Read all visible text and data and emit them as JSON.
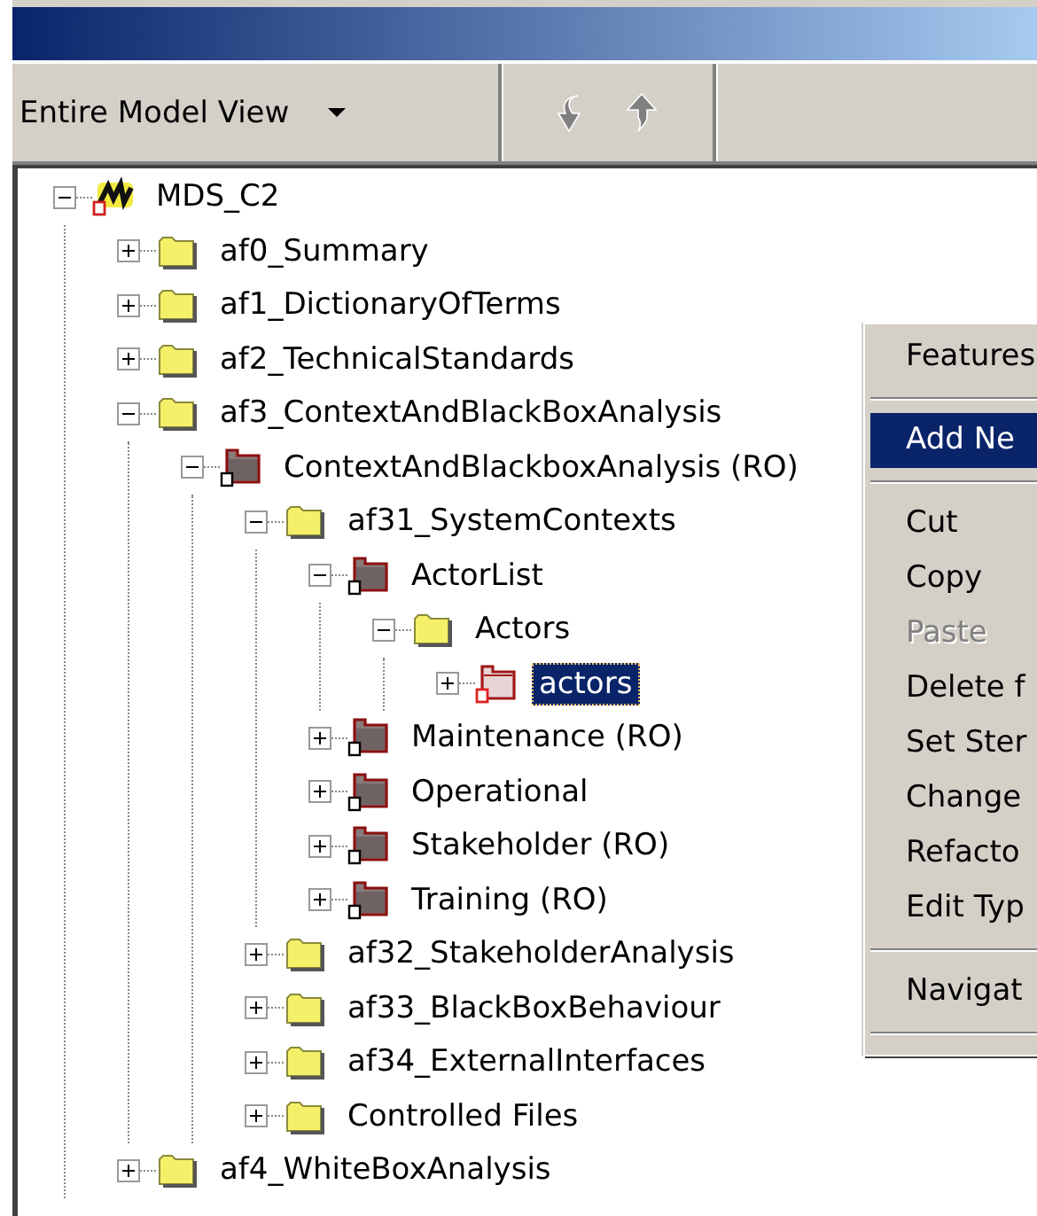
{
  "toolbar": {
    "view_selector": {
      "value": "Entire Model View"
    }
  },
  "tree": [
    {
      "label": "MDS_C2",
      "kind": "model",
      "expanded": true,
      "selected": false,
      "children": [
        {
          "label": "af0_Summary",
          "kind": "folder",
          "expanded": false,
          "selected": false
        },
        {
          "label": "af1_DictionaryOfTerms",
          "kind": "folder",
          "expanded": false,
          "selected": false
        },
        {
          "label": "af2_TechnicalStandards",
          "kind": "folder",
          "expanded": false,
          "selected": false
        },
        {
          "label": "af3_ContextAndBlackBoxAnalysis",
          "kind": "folder",
          "expanded": true,
          "selected": false,
          "children": [
            {
              "label": "ContextAndBlackboxAnalysis (RO)",
              "kind": "package",
              "expanded": true,
              "selected": false,
              "children": [
                {
                  "label": "af31_SystemContexts",
                  "kind": "folder",
                  "expanded": true,
                  "selected": false,
                  "children": [
                    {
                      "label": "ActorList",
                      "kind": "package",
                      "expanded": true,
                      "selected": false,
                      "children": [
                        {
                          "label": "Actors",
                          "kind": "folder",
                          "expanded": true,
                          "selected": false,
                          "children": [
                            {
                              "label": "actors",
                              "kind": "editable-package",
                              "expanded": false,
                              "selected": true
                            }
                          ]
                        }
                      ]
                    },
                    {
                      "label": "Maintenance (RO)",
                      "kind": "package",
                      "expanded": false,
                      "selected": false
                    },
                    {
                      "label": "Operational",
                      "kind": "package",
                      "expanded": false,
                      "selected": false
                    },
                    {
                      "label": "Stakeholder (RO)",
                      "kind": "package",
                      "expanded": false,
                      "selected": false
                    },
                    {
                      "label": "Training (RO)",
                      "kind": "package",
                      "expanded": false,
                      "selected": false
                    }
                  ]
                },
                {
                  "label": "af32_StakeholderAnalysis",
                  "kind": "folder",
                  "expanded": false,
                  "selected": false
                },
                {
                  "label": "af33_BlackBoxBehaviour",
                  "kind": "folder",
                  "expanded": false,
                  "selected": false
                },
                {
                  "label": "af34_ExternalInterfaces",
                  "kind": "folder",
                  "expanded": false,
                  "selected": false
                },
                {
                  "label": "Controlled Files",
                  "kind": "folder",
                  "expanded": false,
                  "selected": false
                }
              ]
            }
          ]
        },
        {
          "label": "af4_WhiteBoxAnalysis",
          "kind": "folder",
          "expanded": false,
          "selected": false
        }
      ]
    }
  ],
  "context_menu": [
    {
      "kind": "item",
      "label": "Features",
      "selected": false,
      "disabled": false
    },
    {
      "kind": "separator"
    },
    {
      "kind": "item",
      "label": "Add Ne",
      "selected": true,
      "disabled": false
    },
    {
      "kind": "separator"
    },
    {
      "kind": "item",
      "label": "Cut",
      "selected": false,
      "disabled": false
    },
    {
      "kind": "item",
      "label": "Copy",
      "selected": false,
      "disabled": false
    },
    {
      "kind": "item",
      "label": "Paste",
      "selected": false,
      "disabled": true
    },
    {
      "kind": "item",
      "label": "Delete f",
      "selected": false,
      "disabled": false
    },
    {
      "kind": "item",
      "label": "Set Ster",
      "selected": false,
      "disabled": false
    },
    {
      "kind": "item",
      "label": "Change",
      "selected": false,
      "disabled": false
    },
    {
      "kind": "item",
      "label": "Refacto",
      "selected": false,
      "disabled": false
    },
    {
      "kind": "item",
      "label": "Edit Typ",
      "selected": false,
      "disabled": false
    },
    {
      "kind": "separator"
    },
    {
      "kind": "item",
      "label": "Navigat",
      "selected": false,
      "disabled": false
    },
    {
      "kind": "separator"
    }
  ]
}
